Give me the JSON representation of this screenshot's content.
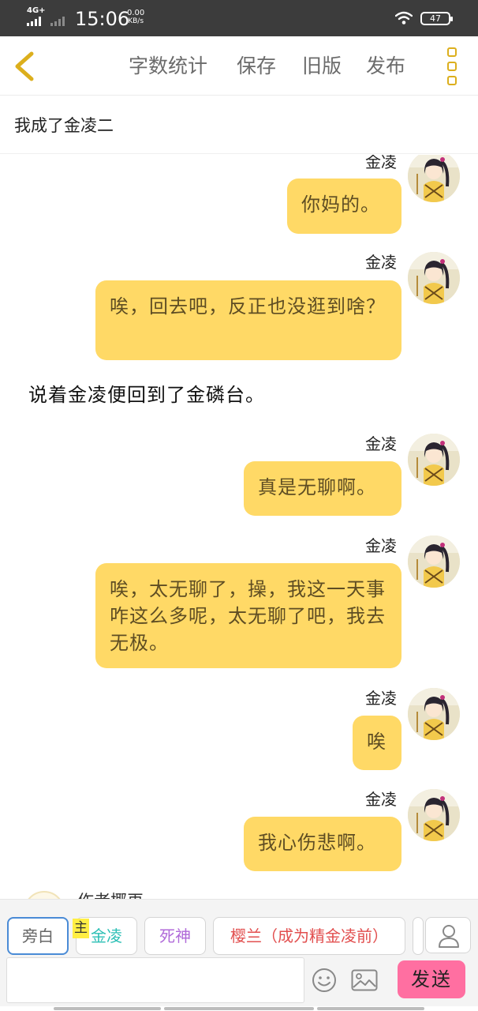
{
  "status_bar": {
    "network": "4G+",
    "time": "15:06",
    "speed_value": "0.00",
    "speed_unit": "KB/s",
    "battery": "47"
  },
  "toolbar": {
    "word_count": "字数统计",
    "save": "保存",
    "old_version": "旧版",
    "publish": "发布"
  },
  "story": {
    "title": "我成了金凌二"
  },
  "messages": [
    {
      "speaker": "金凌",
      "text": "你妈的。"
    },
    {
      "speaker": "金凌",
      "text": "唉，回去吧，反正也没逛到啥？"
    },
    {
      "narration": "说着金凌便回到了金磷台。"
    },
    {
      "speaker": "金凌",
      "text": "真是无聊啊。"
    },
    {
      "speaker": "金凌",
      "text": "唉，太无聊了，操，我这一天事咋这么多呢，太无聊了吧，我去无极。"
    },
    {
      "speaker": "金凌",
      "text": "唉"
    },
    {
      "speaker": "金凌",
      "text": "我心伤悲啊。"
    }
  ],
  "author": {
    "name": "作者椰再"
  },
  "roles": {
    "narrator": "旁白",
    "main_badge": "主",
    "role1": "金凌",
    "role2": "死神",
    "role3": "樱兰（成为精金凌前）"
  },
  "input": {
    "send": "发送"
  },
  "colors": {
    "bubble": "#ffd966",
    "accent_yellow": "#dcaf1d",
    "send_button": "#ff6fa1",
    "role1": "#2bbfb5",
    "role2": "#b06ad9",
    "role3": "#e24f4f"
  },
  "icons": [
    "back-chevron-icon",
    "more-icon",
    "wifi-icon",
    "battery-icon",
    "person-icon",
    "emoji-icon",
    "image-icon"
  ]
}
